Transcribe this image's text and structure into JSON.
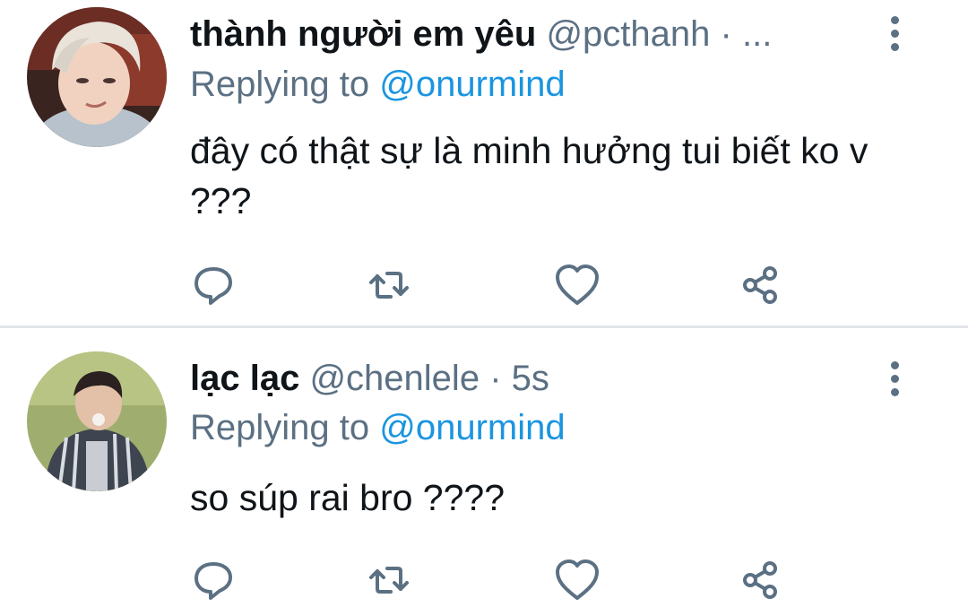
{
  "tweets": [
    {
      "display_name": "thành người em yêu",
      "handle": "@pcthanh",
      "separator": "·",
      "time": "...",
      "replying_prefix": "Replying to",
      "replying_to": "@onurmind",
      "text": "đây có thật sự là minh hưởng tui biết ko v ???",
      "avatar_icon": "avatar-blond-person"
    },
    {
      "display_name": "lạc lạc",
      "handle": "@chenlele",
      "separator": "·",
      "time": "5s",
      "replying_prefix": "Replying to",
      "replying_to": "@onurmind",
      "text": "so súp rai bro ????",
      "avatar_icon": "avatar-striped-shirt-person"
    }
  ],
  "actions": {
    "reply_icon": "reply-icon",
    "retweet_icon": "retweet-icon",
    "like_icon": "heart-icon",
    "share_icon": "share-icon"
  },
  "colors": {
    "text_primary": "#0f1419",
    "text_secondary": "#5b7083",
    "mention": "#1b95e0",
    "divider": "#e1e6ea"
  }
}
